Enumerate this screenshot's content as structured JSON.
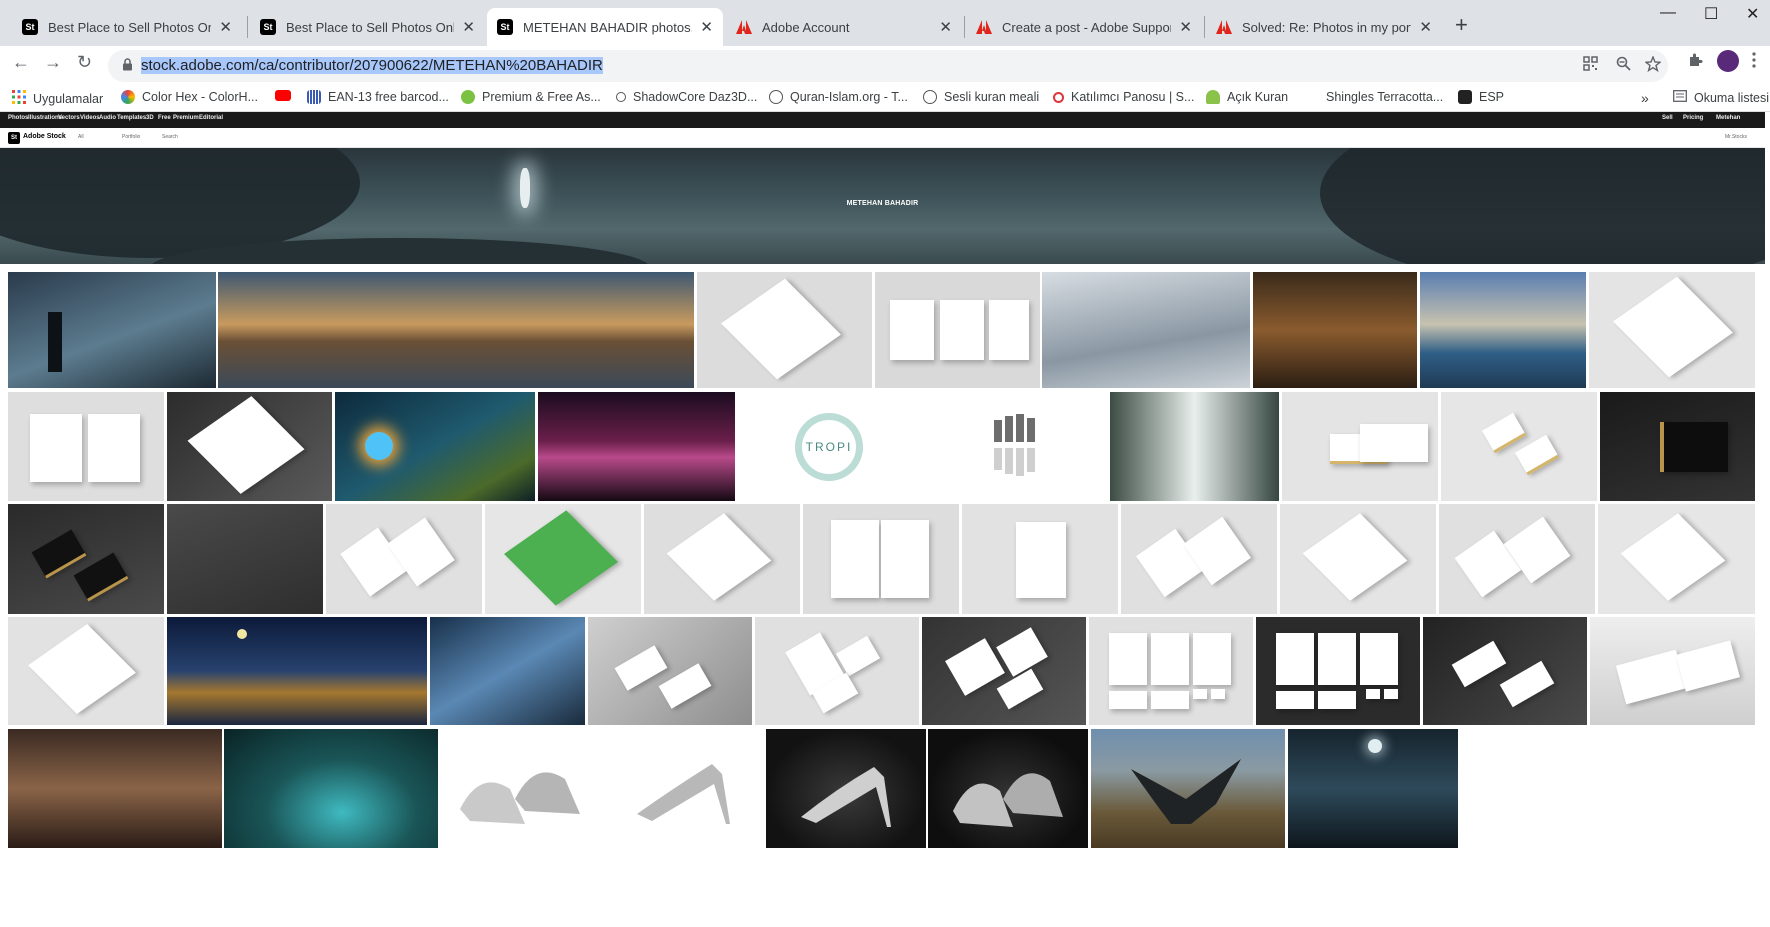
{
  "browser": {
    "tabs": [
      {
        "title": "Best Place to Sell Photos Online,",
        "icon": "st",
        "active": false
      },
      {
        "title": "Best Place to Sell Photos Online,",
        "icon": "st",
        "active": false
      },
      {
        "title": "METEHAN BAHADIR photos, ima",
        "icon": "st",
        "active": true
      },
      {
        "title": "Adobe Account",
        "icon": "adobe",
        "active": false
      },
      {
        "title": "Create a post - Adobe Support C",
        "icon": "adobe",
        "active": false
      },
      {
        "title": "Solved: Re: Photos in my portfolio",
        "icon": "adobe",
        "active": false
      }
    ],
    "tab_icon_text": "St",
    "close_glyph": "✕",
    "new_tab_glyph": "+",
    "window_controls": {
      "minimize": "—",
      "maximize": "☐",
      "close": "✕"
    },
    "nav": {
      "back": "←",
      "forward": "→",
      "reload": "↻"
    },
    "url": "stock.adobe.com/ca/contributor/207900622/METEHAN%20BAHADIR",
    "bookmarks": [
      {
        "label": "Uygulamalar",
        "color": "#ea4335"
      },
      {
        "label": "Color Hex - ColorH...",
        "color": "#4285f4"
      },
      {
        "label": "",
        "color": "#ff0000"
      },
      {
        "label": "EAN-13 free barcod...",
        "color": "#3c5bb6"
      },
      {
        "label": "Premium & Free As...",
        "color": "#7cc242"
      },
      {
        "label": "ShadowCore Daz3D...",
        "color": "#555555"
      },
      {
        "label": "Quran-Islam.org - T...",
        "color": "#555555"
      },
      {
        "label": "Sesli kuran meali",
        "color": "#555555"
      },
      {
        "label": "Katılımcı Panosu | S...",
        "color": "#e0353a"
      },
      {
        "label": "Açık Kuran",
        "color": "#8bc34a"
      },
      {
        "label": "Shingles Terracotta...",
        "color": "#ffffff"
      },
      {
        "label": "ESP",
        "color": "#222222"
      }
    ],
    "more_bookmarks": "»",
    "reading_list": "Okuma listesi"
  },
  "stock": {
    "nav_items": [
      "Photos",
      "Illustrations",
      "Vectors",
      "Videos",
      "Audio",
      "Templates",
      "3D",
      "Free",
      "Premium",
      "Editorial"
    ],
    "nav_right": [
      "Sell",
      "Pricing",
      "Metehan"
    ],
    "logo_text": "St",
    "brand": "Adobe Stock",
    "search_bar": {
      "filter": "All",
      "portfolio": "Portfolio",
      "search": "Search",
      "user": "Mr.Stocks"
    },
    "banner_title": "METEHAN BAHADIR"
  },
  "colors": {
    "accent": "#1a73e8",
    "selection": "#a8c7fa"
  }
}
